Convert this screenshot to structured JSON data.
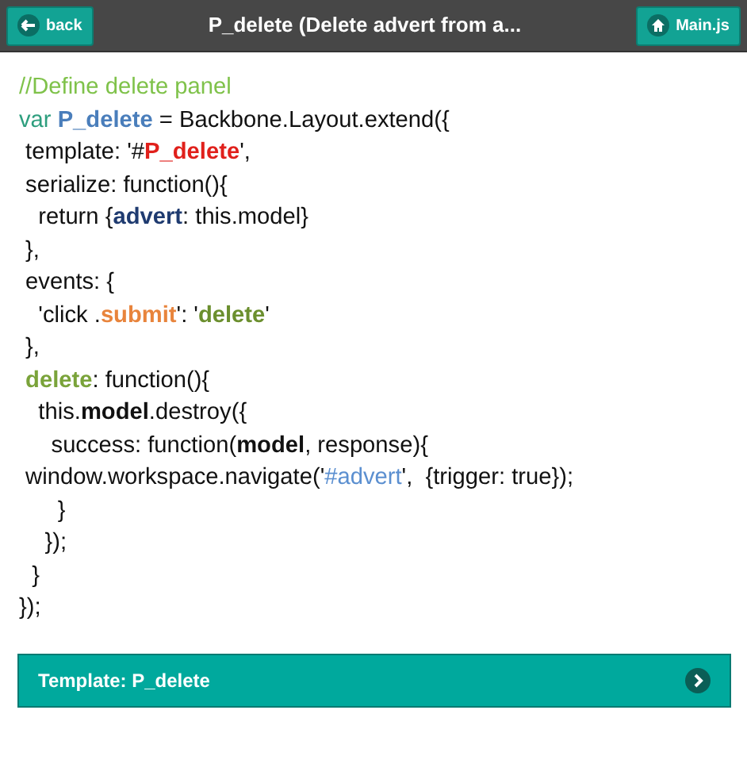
{
  "header": {
    "back": "back",
    "title": "P_delete (Delete advert from a...",
    "home": "Main.js"
  },
  "code": [
    [
      {
        "t": "//Define delete panel",
        "color": "#7fc24a",
        "bold": false
      }
    ],
    [
      {
        "t": "var ",
        "color": "#2e9e7e",
        "bold": false
      },
      {
        "t": "P_delete",
        "color": "#4a7ebb",
        "bold": true
      },
      {
        "t": " = Backbone.Layout.extend({",
        "color": "#111111",
        "bold": false
      }
    ],
    [
      {
        "t": " template: '#",
        "color": "#111111",
        "bold": false
      },
      {
        "t": "P_delete",
        "color": "#e0201b",
        "bold": true
      },
      {
        "t": "',",
        "color": "#111111",
        "bold": false
      }
    ],
    [
      {
        "t": " serialize: function(){",
        "color": "#111111",
        "bold": false
      }
    ],
    [
      {
        "t": "   return {",
        "color": "#111111",
        "bold": false
      },
      {
        "t": "advert",
        "color": "#1f3b70",
        "bold": true
      },
      {
        "t": ": this.model}",
        "color": "#111111",
        "bold": false
      }
    ],
    [
      {
        "t": " },",
        "color": "#111111",
        "bold": false
      }
    ],
    [
      {
        "t": " events: {",
        "color": "#111111",
        "bold": false
      }
    ],
    [
      {
        "t": "   'click .",
        "color": "#111111",
        "bold": false
      },
      {
        "t": "submit",
        "color": "#e8843c",
        "bold": true
      },
      {
        "t": "': '",
        "color": "#111111",
        "bold": false
      },
      {
        "t": "delete",
        "color": "#6b8f2e",
        "bold": true
      },
      {
        "t": "'",
        "color": "#111111",
        "bold": false
      }
    ],
    [
      {
        "t": " },",
        "color": "#111111",
        "bold": false
      }
    ],
    [
      {
        "t": " delete",
        "color": "#7aa33a",
        "bold": true
      },
      {
        "t": ": function(){",
        "color": "#111111",
        "bold": false
      }
    ],
    [
      {
        "t": "   this.",
        "color": "#111111",
        "bold": false
      },
      {
        "t": "model",
        "color": "#111111",
        "bold": true
      },
      {
        "t": ".destroy({",
        "color": "#111111",
        "bold": false
      }
    ],
    [
      {
        "t": "     success: function(",
        "color": "#111111",
        "bold": false
      },
      {
        "t": "model",
        "color": "#111111",
        "bold": true
      },
      {
        "t": ", response){",
        "color": "#111111",
        "bold": false
      }
    ],
    [
      {
        "t": " window.workspace.navigate('",
        "color": "#111111",
        "bold": false
      },
      {
        "t": "#advert",
        "color": "#5b8fd0",
        "bold": false
      },
      {
        "t": "',  {trigger: true});",
        "color": "#111111",
        "bold": false
      }
    ],
    [
      {
        "t": "      }",
        "color": "#111111",
        "bold": false
      }
    ],
    [
      {
        "t": "    });",
        "color": "#111111",
        "bold": false
      }
    ],
    [
      {
        "t": "  }",
        "color": "#111111",
        "bold": false
      }
    ],
    [
      {
        "t": "});",
        "color": "#111111",
        "bold": false
      }
    ]
  ],
  "link": {
    "label": "Template: P_delete"
  }
}
